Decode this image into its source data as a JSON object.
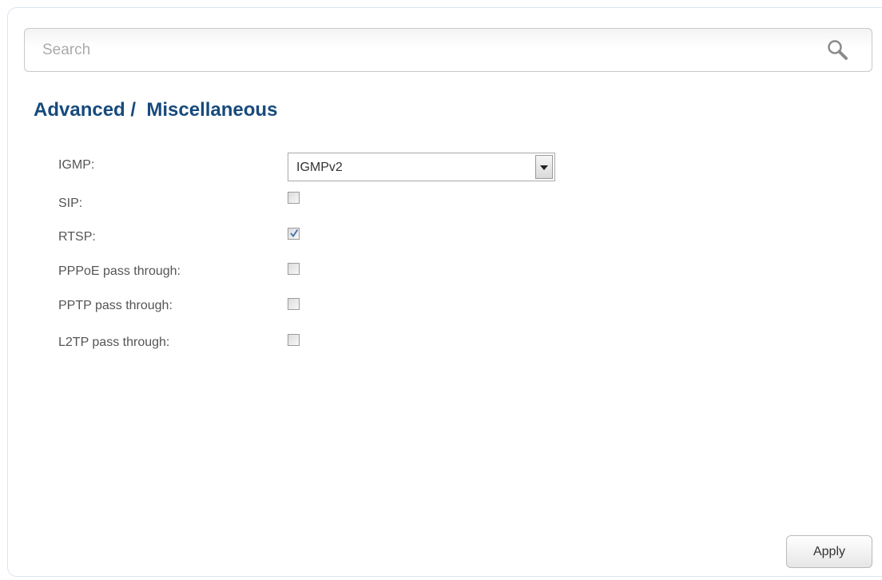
{
  "search": {
    "placeholder": "Search",
    "value": "",
    "icon": "search-icon"
  },
  "page": {
    "title": "Advanced /  Miscellaneous"
  },
  "form": {
    "igmp": {
      "label": "IGMP:",
      "selected": "IGMPv2"
    },
    "sip": {
      "label": "SIP:",
      "checked": false
    },
    "rtsp": {
      "label": "RTSP:",
      "checked": true
    },
    "pppoe": {
      "label": "PPPoE pass through:",
      "checked": false
    },
    "pptp": {
      "label": "PPTP pass through:",
      "checked": false
    },
    "l2tp": {
      "label": "L2TP pass through:",
      "checked": false
    }
  },
  "actions": {
    "apply_label": "Apply"
  },
  "colors": {
    "title": "#174a7c",
    "label": "#555555",
    "check": "#3a6fb0"
  }
}
